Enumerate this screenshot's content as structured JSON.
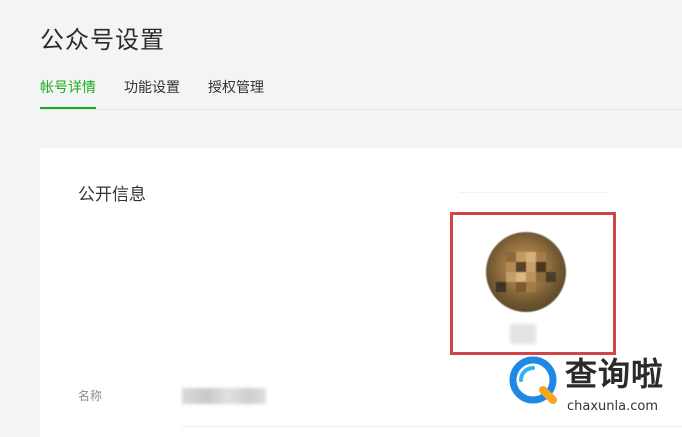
{
  "page": {
    "title": "公众号设置"
  },
  "tabs": [
    {
      "label": "帐号详情",
      "active": true
    },
    {
      "label": "功能设置",
      "active": false
    },
    {
      "label": "授权管理",
      "active": false
    }
  ],
  "panel": {
    "section_title": "公开信息",
    "avatar_caption": "",
    "fields": [
      {
        "label": "名称",
        "value": ""
      }
    ]
  },
  "colors": {
    "accent": "#1aad19",
    "highlight_box": "#d34448",
    "page_bg": "#f3f4f6",
    "panel_bg": "#ffffff"
  },
  "watermark": {
    "text": "查询啦",
    "sub": "chaxunla.com",
    "icon": "search-q-icon"
  }
}
